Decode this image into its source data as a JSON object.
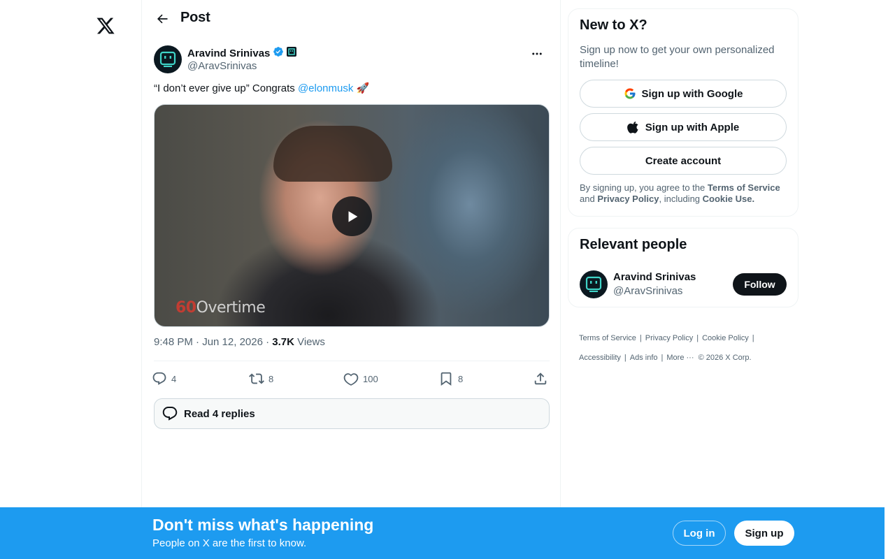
{
  "header": {
    "title": "Post"
  },
  "post": {
    "author_name": "Aravind Srinivas",
    "author_handle": "@AravSrinivas",
    "text_prefix": "“I don’t ever give up” Congrats ",
    "mention": "@elonmusk",
    "text_suffix": " 🚀",
    "media_watermark_num": "60",
    "media_watermark_word": "Overtime",
    "time": "9:48 PM · Jun 12, 2026 · ",
    "views_count": "3.7K",
    "views_label": " Views",
    "replies": "4",
    "reposts": "8",
    "likes": "100",
    "bookmarks": "8",
    "read_replies": "Read 4 replies"
  },
  "signup_card": {
    "title": "New to X?",
    "subtitle": "Sign up now to get your own personalized timeline!",
    "google": "Sign up with Google",
    "apple": "Sign up with Apple",
    "create": "Create account",
    "legal_1": "By signing up, you agree to the ",
    "terms": "Terms of Service",
    "legal_2": " and ",
    "privacy": "Privacy Policy",
    "legal_3": ", including ",
    "cookie": "Cookie Use."
  },
  "relevant": {
    "title": "Relevant people",
    "name": "Aravind Srinivas",
    "handle": "@AravSrinivas",
    "follow": "Follow"
  },
  "footer": {
    "terms": "Terms of Service",
    "privacy": "Privacy Policy",
    "cookie": "Cookie Policy",
    "accessibility": "Accessibility",
    "ads": "Ads info",
    "more": "More ···",
    "copyright": "© 2026 X Corp."
  },
  "banner": {
    "title": "Don't miss what's happening",
    "subtitle": "People on X are the first to know.",
    "login": "Log in",
    "signup": "Sign up"
  },
  "colors": {
    "accent": "#1d9bf0",
    "text": "#0f1419",
    "muted": "#536471"
  }
}
